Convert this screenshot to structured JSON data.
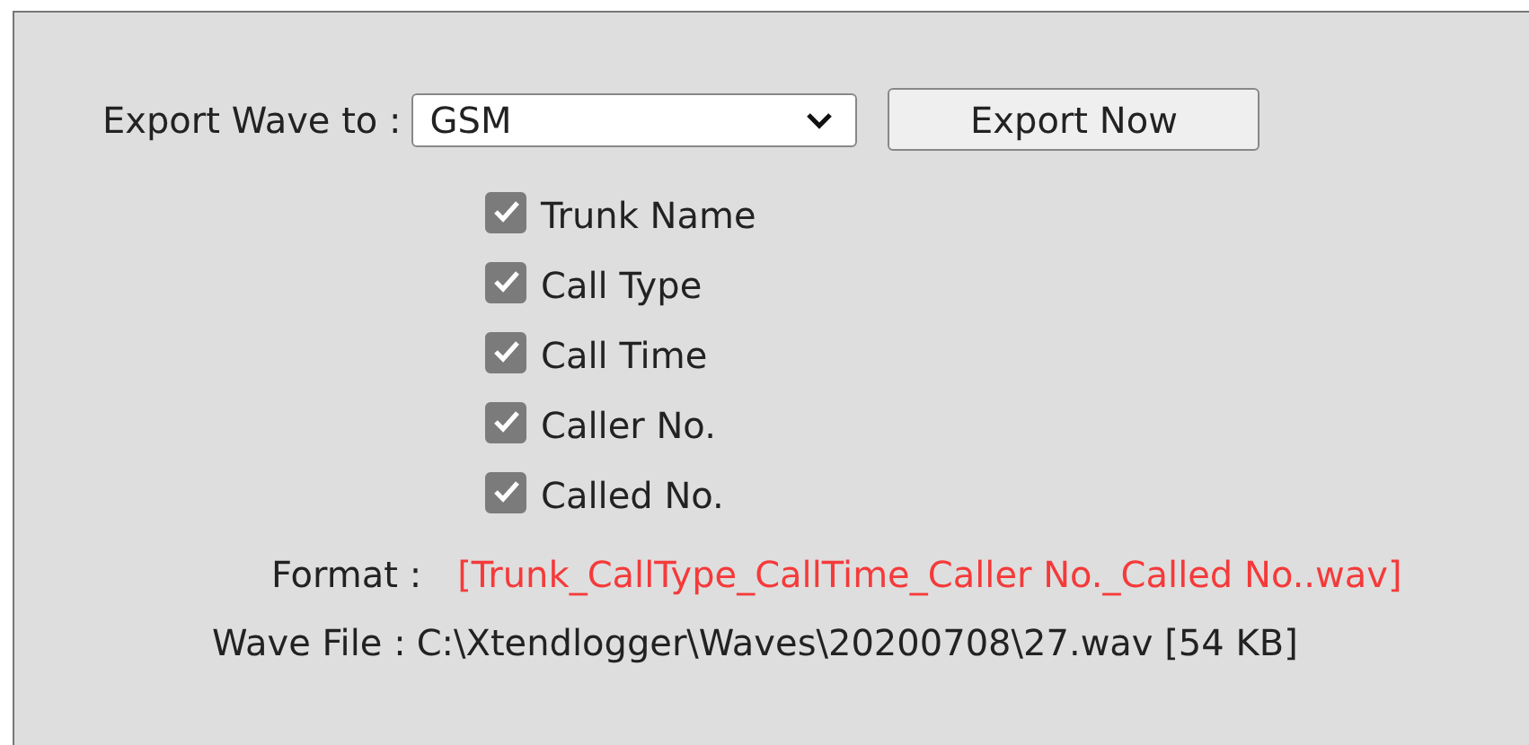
{
  "export": {
    "label": "Export Wave to :",
    "format_value": "GSM",
    "button": "Export Now"
  },
  "fields": [
    {
      "label": "Trunk Name",
      "checked": true
    },
    {
      "label": "Call Type",
      "checked": true
    },
    {
      "label": "Call Time",
      "checked": true
    },
    {
      "label": "Caller No.",
      "checked": true
    },
    {
      "label": "Called No.",
      "checked": true
    }
  ],
  "format": {
    "label": "Format :",
    "value": "[Trunk_CallType_CallTime_Caller No._Called No..wav]"
  },
  "wave_file": {
    "label": "Wave File :",
    "value": "C:\\Xtendlogger\\Waves\\20200708\\27.wav [54 KB]"
  }
}
